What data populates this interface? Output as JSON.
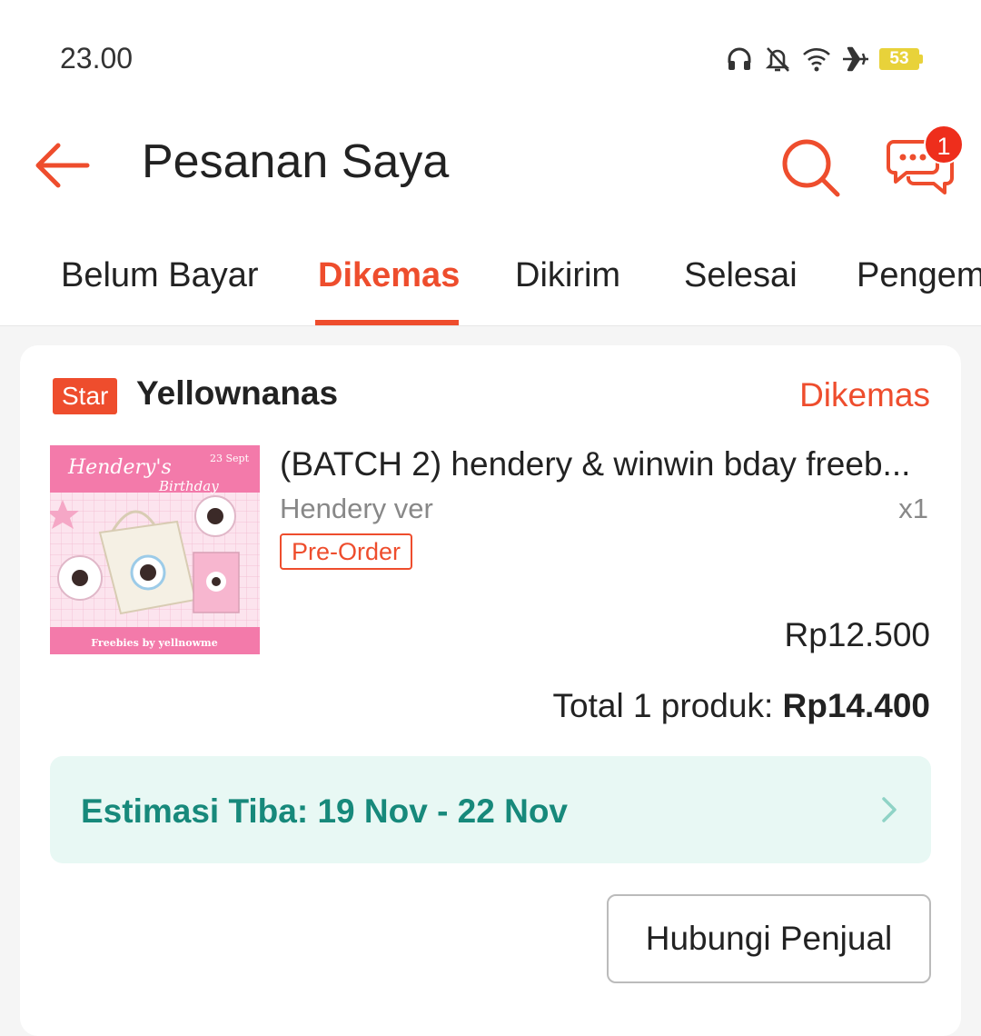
{
  "status_bar": {
    "time": "23.00",
    "battery_level": "53",
    "icons": [
      "headphones-icon",
      "bell-off-icon",
      "wifi-icon",
      "airplane-icon",
      "battery-icon"
    ]
  },
  "header": {
    "title": "Pesanan Saya",
    "chat_badge": "1",
    "icons": [
      "back-arrow-icon",
      "search-icon",
      "chat-icon"
    ]
  },
  "tabs": {
    "items": [
      "Belum Bayar",
      "Dikemas",
      "Dikirim",
      "Selesai",
      "Pengem"
    ],
    "active": "Dikemas"
  },
  "order": {
    "shop_badge": "Star",
    "shop_name": "Yellownanas",
    "status": "Dikemas",
    "product": {
      "name": "(BATCH 2) hendery & winwin bday freeb...",
      "variant": "Hendery ver",
      "quantity": "x1",
      "tag": "Pre-Order",
      "price": "Rp12.500",
      "image": {
        "title_line1": "Hendery's",
        "title_line2": "Birthday",
        "date": "23 Sept",
        "footer": "Freebies by yellnowme"
      }
    },
    "total_label": "Total 1 produk:",
    "total_value": "Rp14.400",
    "estimate": "Estimasi Tiba: 19 Nov - 22 Nov",
    "contact_button": "Hubungi Penjual"
  },
  "colors": {
    "accent": "#ee4d2d",
    "estimate_bg": "#e8f8f4",
    "estimate_text": "#17897b",
    "battery": "#e8d23a"
  }
}
